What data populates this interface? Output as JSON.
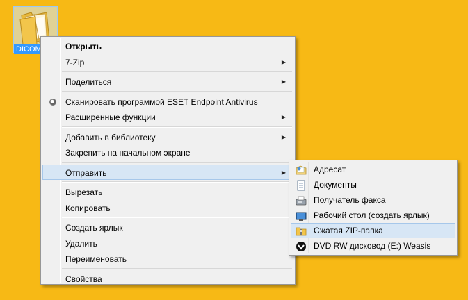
{
  "desktop": {
    "icon_label": "DICOM",
    "icon_name": "folder-icon"
  },
  "context_menu": {
    "items": [
      {
        "label": "Открыть"
      },
      {
        "label": "7-Zip"
      },
      {
        "label": "Поделиться"
      },
      {
        "label": "Сканировать программой ESET Endpoint Antivirus"
      },
      {
        "label": "Расширенные функции"
      },
      {
        "label": "Добавить в библиотеку"
      },
      {
        "label": "Закрепить на начальном экране"
      },
      {
        "label": "Отправить"
      },
      {
        "label": "Вырезать"
      },
      {
        "label": "Копировать"
      },
      {
        "label": "Создать ярлык"
      },
      {
        "label": "Удалить"
      },
      {
        "label": "Переименовать"
      },
      {
        "label": "Свойства"
      }
    ]
  },
  "send_to_menu": {
    "items": [
      {
        "label": "Адресат",
        "icon": "mail-recipient-icon"
      },
      {
        "label": "Документы",
        "icon": "documents-icon"
      },
      {
        "label": "Получатель факса",
        "icon": "fax-icon"
      },
      {
        "label": "Рабочий стол (создать ярлык)",
        "icon": "desktop-icon"
      },
      {
        "label": "Сжатая ZIP-папка",
        "icon": "zip-folder-icon"
      },
      {
        "label": "DVD RW дисковод (E:) Weasis",
        "icon": "dvd-drive-icon"
      }
    ]
  },
  "colors": {
    "desktop_background": "#f7b915",
    "menu_background": "#f0f0f0",
    "highlight": "#d7e6f5"
  }
}
